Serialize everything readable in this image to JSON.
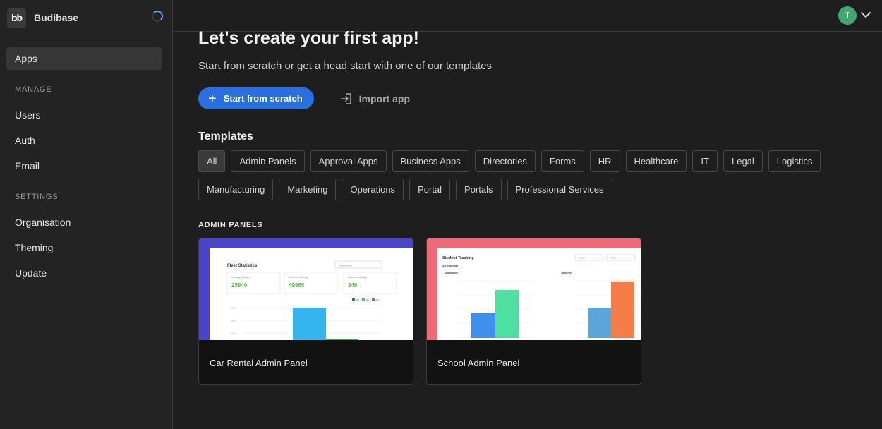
{
  "brand": {
    "logo_text": "bb",
    "name": "Budibase"
  },
  "sidebar": {
    "items_top": [
      {
        "label": "Apps"
      }
    ],
    "manage_label": "MANAGE",
    "manage_items": [
      {
        "label": "Users"
      },
      {
        "label": "Auth"
      },
      {
        "label": "Email"
      }
    ],
    "settings_label": "SETTINGS",
    "settings_items": [
      {
        "label": "Organisation"
      },
      {
        "label": "Theming"
      },
      {
        "label": "Update"
      }
    ]
  },
  "header": {
    "avatar_initial": "T"
  },
  "main": {
    "title": "Let's create your first app!",
    "subtitle": "Start from scratch or get a head start with one of our templates",
    "start_button": "Start from scratch",
    "import_button": "Import app",
    "templates_heading": "Templates",
    "categories": [
      "All",
      "Admin Panels",
      "Approval Apps",
      "Business Apps",
      "Directories",
      "Forms",
      "HR",
      "Healthcare",
      "IT",
      "Legal",
      "Logistics",
      "Manufacturing",
      "Marketing",
      "Operations",
      "Portal",
      "Portals",
      "Professional Services"
    ],
    "section_label": "ADMIN PANELS",
    "cards": [
      {
        "title": "Car Rental Admin Panel",
        "preview": {
          "heading": "Fleet Statistics",
          "dropdown": "Availability",
          "stats": [
            {
              "label": "Average Mileage",
              "value": "25840"
            },
            {
              "label": "Maximum Mileage",
              "value": "49965"
            },
            {
              "label": "Minimum Mileage",
              "value": "349"
            }
          ],
          "legend": [
            "Min",
            "Max",
            "Avg"
          ],
          "ticks": [
            "60000",
            "50000",
            "40000"
          ]
        }
      },
      {
        "title": "School Admin Panel",
        "preview": {
          "heading": "Student Tracking",
          "sub": "All Students",
          "filters": [
            "Gender",
            "Grade"
          ],
          "left_label": "Attendance",
          "right_label": "Tardiness"
        }
      }
    ]
  },
  "colors": {
    "accent": "#2a6fe0",
    "avatar": "#3fa874",
    "card1_bg": "#4a45c8",
    "card2_bg": "#ef6a78"
  }
}
